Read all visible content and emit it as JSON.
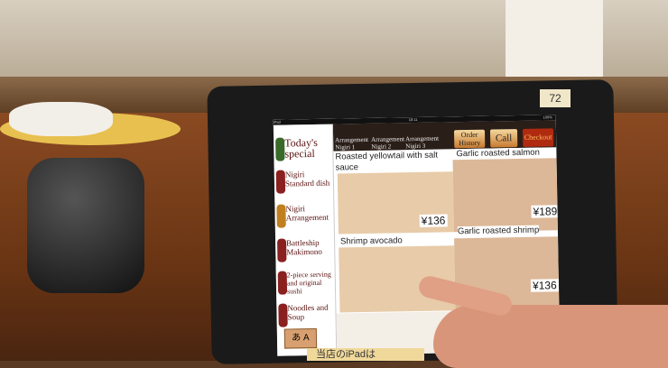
{
  "table_number": "72",
  "screen": {
    "status_bar": {
      "carrier": "iPad",
      "time": "18:11",
      "battery": "100%"
    },
    "sidebar": [
      {
        "label": "Today's special"
      },
      {
        "label": "Nigiri Standard dish"
      },
      {
        "label": "Nigiri Arrangement"
      },
      {
        "label": "Battleship Makimono"
      },
      {
        "label": "2-piece serving and original sushi"
      },
      {
        "label": "Noodles and Soup"
      }
    ],
    "tabs": [
      {
        "label": "Arrangement Nigiri 1"
      },
      {
        "label": "Arrangement Nigiri 2"
      },
      {
        "label": "Arrangement Nigiri 3"
      }
    ],
    "buttons": {
      "order_history": "Order History",
      "call": "Call",
      "checkout": "Checkout"
    },
    "items": [
      {
        "name": "Roasted yellowtail with salt sauce",
        "price": "¥136"
      },
      {
        "name": "Garlic roasted salmon",
        "price": "¥189"
      },
      {
        "name": "Shrimp avocado",
        "price": ""
      },
      {
        "name": "Garlic roasted shrimp",
        "price": "¥136"
      }
    ],
    "language_button": "あ A"
  },
  "sign_text": "当店のiPadは"
}
